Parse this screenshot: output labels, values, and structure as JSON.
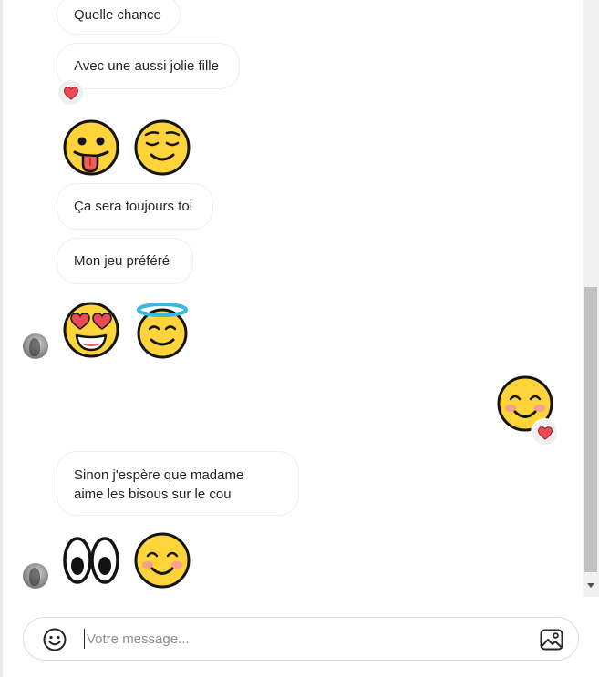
{
  "messages": [
    {
      "text": "Quelle chance"
    },
    {
      "text": "Avec une aussi jolie fille"
    },
    {
      "text": "Ça sera toujours toi"
    },
    {
      "text": "Mon jeu préféré"
    },
    {
      "text_line1": "Sinon j'espère que madame",
      "text_line2": "aime les bisous sur le cou"
    }
  ],
  "emojis": {
    "tongue": "tongue-out-face",
    "relieved": "relieved-face",
    "heart_eyes": "heart-eyes-face",
    "halo": "halo-face",
    "blush": "blushing-face",
    "eyes": "eyes"
  },
  "composer": {
    "placeholder": "Votre message..."
  },
  "colors": {
    "heart": "#ed4956",
    "emoji_yellow": "#ffd43b",
    "bubble_border": "#efefef",
    "halo": "#3ab7e3"
  }
}
